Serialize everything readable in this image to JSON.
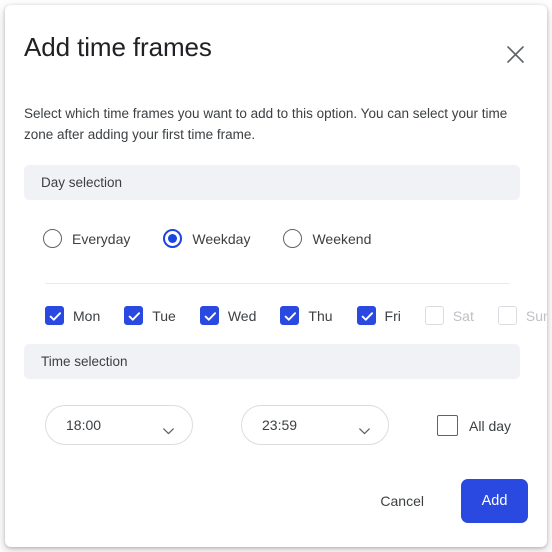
{
  "dialog": {
    "title": "Add time frames",
    "close_icon": "close-icon",
    "description": "Select which time frames you want to add to this option. You can select your time zone after adding your first time frame."
  },
  "day_section": {
    "band_label": "Day selection",
    "radios": [
      {
        "label": "Everyday",
        "selected": false
      },
      {
        "label": "Weekday",
        "selected": true
      },
      {
        "label": "Weekend",
        "selected": false
      }
    ],
    "days": [
      {
        "label": "Mon",
        "checked": true,
        "disabled": false
      },
      {
        "label": "Tue",
        "checked": true,
        "disabled": false
      },
      {
        "label": "Wed",
        "checked": true,
        "disabled": false
      },
      {
        "label": "Thu",
        "checked": true,
        "disabled": false
      },
      {
        "label": "Fri",
        "checked": true,
        "disabled": false
      },
      {
        "label": "Sat",
        "checked": false,
        "disabled": true
      },
      {
        "label": "Sun",
        "checked": false,
        "disabled": true
      }
    ]
  },
  "time_section": {
    "band_label": "Time selection",
    "start_time": "18:00",
    "end_time": "23:59",
    "all_day_label": "All day",
    "all_day_checked": false
  },
  "footer": {
    "cancel_label": "Cancel",
    "add_label": "Add"
  },
  "colors": {
    "accent": "#2a49e0",
    "radio_accent": "#1a45e0",
    "band_background": "#f1f2f6",
    "text_primary": "#202124",
    "text_secondary": "#3c4043",
    "text_disabled": "#bdc1c6",
    "border": "#dadce0",
    "divider": "#e8eaed"
  }
}
